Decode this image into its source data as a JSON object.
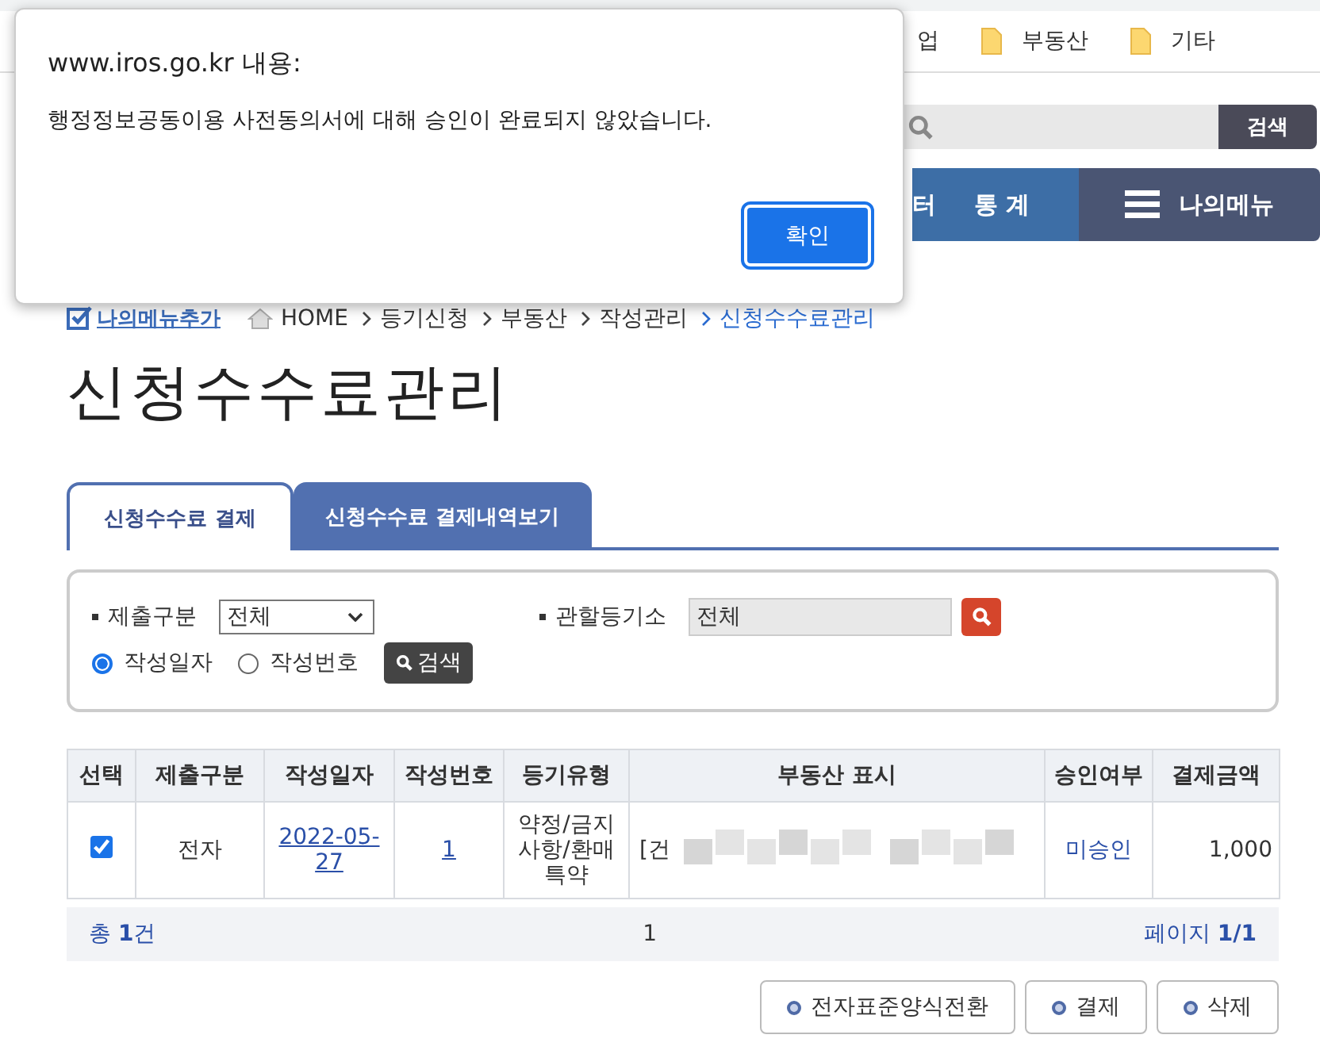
{
  "bookmarks": [
    {
      "label": "업"
    },
    {
      "label": "부동산"
    },
    {
      "label": "기타"
    }
  ],
  "header_search": {
    "button": "검색"
  },
  "nav": {
    "items": [
      "터",
      "통 계"
    ],
    "my_menu": "나의메뉴"
  },
  "breadcrumb": {
    "add_menu": "나의메뉴추가",
    "items": [
      {
        "label": "HOME",
        "current": false
      },
      {
        "label": "등기신청",
        "current": false
      },
      {
        "label": "부동산",
        "current": false
      },
      {
        "label": "작성관리",
        "current": false
      },
      {
        "label": "신청수수료관리",
        "current": true
      }
    ]
  },
  "page_title": "신청수수료관리",
  "tabs": [
    {
      "label": "신청수수료 결제",
      "selected": true
    },
    {
      "label": "신청수수료 결제내역보기",
      "selected": false
    }
  ],
  "filter": {
    "submit_type_label": "제출구분",
    "submit_type_value": "전체",
    "office_label": "관할등기소",
    "office_value": "전체",
    "sort_options": [
      {
        "label": "작성일자",
        "selected": true
      },
      {
        "label": "작성번호",
        "selected": false
      }
    ],
    "search_button": "검색"
  },
  "table": {
    "columns": [
      "선택",
      "제출구분",
      "작성일자",
      "작성번호",
      "등기유형",
      "부동산 표시",
      "승인여부",
      "결제금액"
    ],
    "rows": [
      {
        "checked": true,
        "submit_type": "전자",
        "date": "2022-05-27",
        "number": "1",
        "type": "약정/금지사항/환매특약",
        "property": "[건",
        "approval": "미승인",
        "amount": "1,000"
      }
    ]
  },
  "summary": {
    "total": "총 **1**건",
    "pages": "1",
    "page_info": "페이지 **1/1**"
  },
  "buttons": [
    "전자표준양식전환",
    "결제",
    "삭제"
  ],
  "dialog": {
    "title": "www.iros.go.kr 내용:",
    "message": "행정정보공동이용 사전동의서에 대해 승인이 완료되지 않았습니다.",
    "ok": "확인"
  }
}
